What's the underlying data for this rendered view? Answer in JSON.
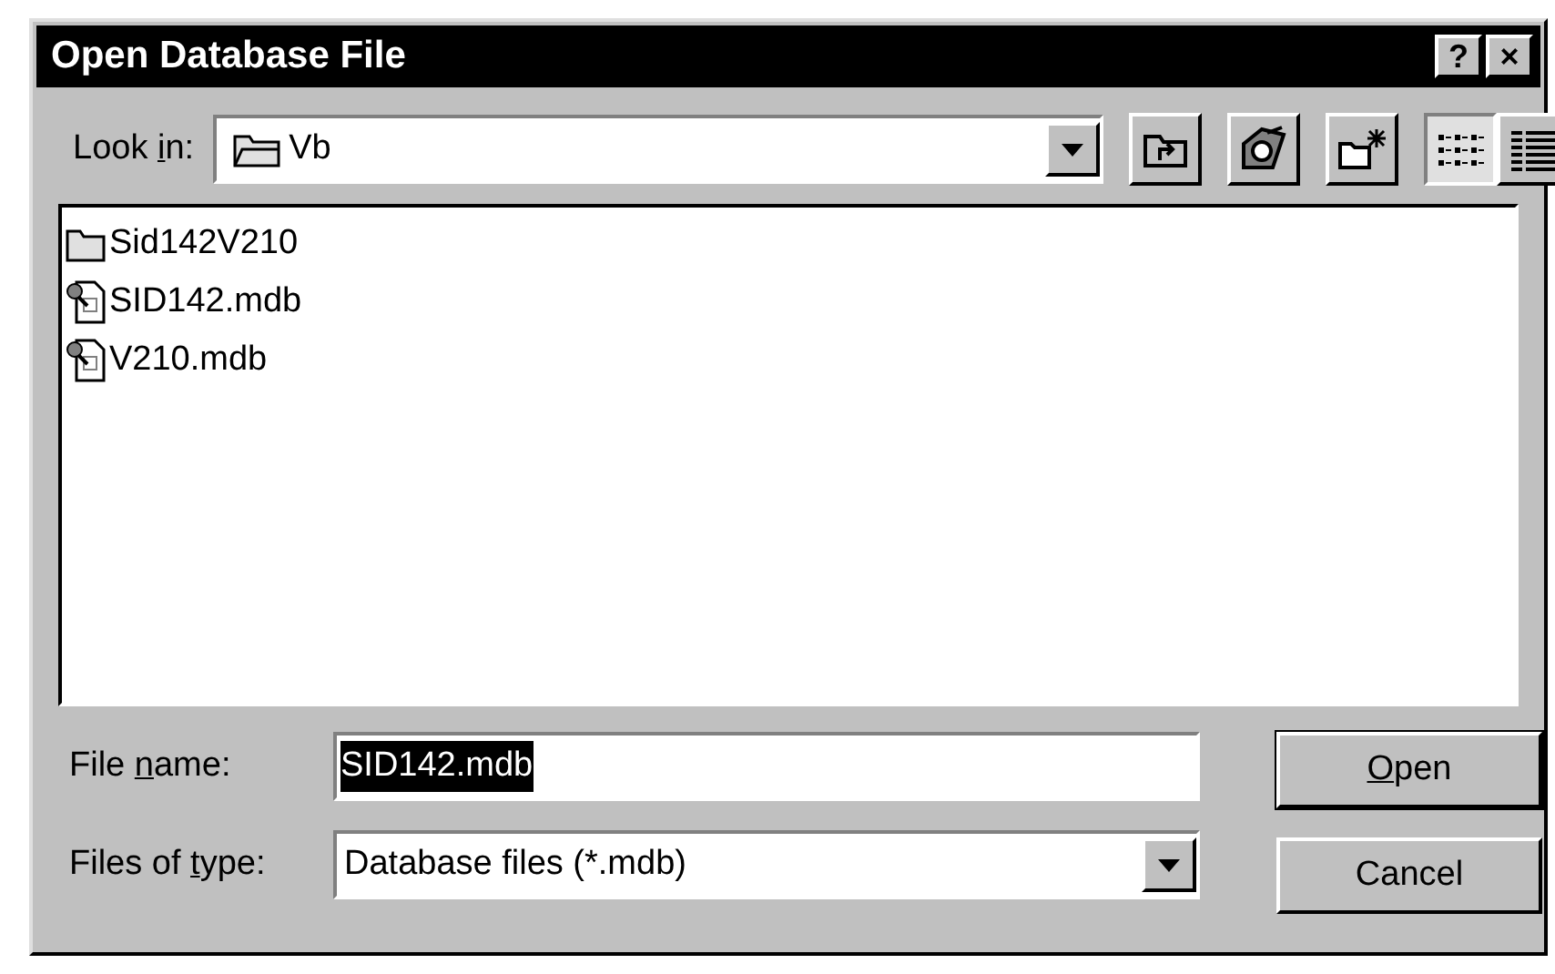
{
  "window": {
    "title": "Open Database File",
    "title_buttons": [
      "?",
      "×"
    ]
  },
  "look_in": {
    "label_parts": [
      "Look ",
      "i",
      "n:"
    ],
    "value": "Vb"
  },
  "toolbar": [
    {
      "kind": "up"
    },
    {
      "kind": "favorites"
    },
    {
      "kind": "newfolder"
    },
    {
      "kind": "list",
      "selected": true
    },
    {
      "kind": "details",
      "selected": false
    }
  ],
  "files": [
    {
      "kind": "folder",
      "name": "Sid142V210",
      "selected": false
    },
    {
      "kind": "mdb",
      "name": "SID142.mdb",
      "selected": false
    },
    {
      "kind": "mdb",
      "name": "V210.mdb",
      "selected": false
    }
  ],
  "file_name": {
    "label_parts": [
      "File ",
      "n",
      "ame:"
    ],
    "value": "SID142.mdb"
  },
  "file_type": {
    "label_parts": [
      "Files of ",
      "t",
      "ype:"
    ],
    "value": "Database files (*.mdb)"
  },
  "buttons": [
    {
      "key": "O",
      "after": "pen",
      "default": true
    },
    {
      "label": "Cancel",
      "default": false
    }
  ]
}
